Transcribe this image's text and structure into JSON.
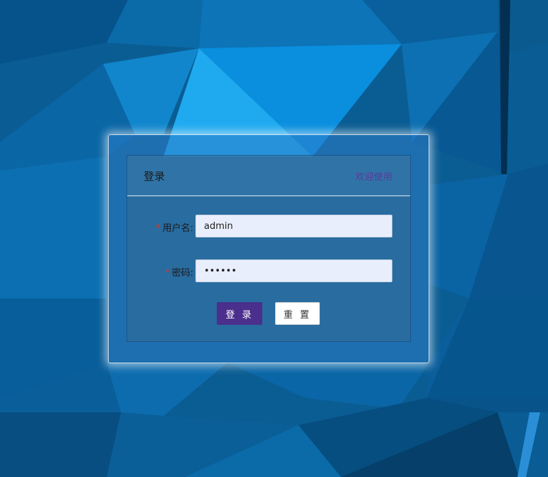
{
  "card": {
    "title": "登录",
    "welcome": "欢迎使用"
  },
  "form": {
    "username_label": "用户名:",
    "username_value": "admin",
    "password_label": "密码:",
    "password_value": "123456",
    "required_mark": "*"
  },
  "buttons": {
    "login_label": "登 录",
    "reset_label": "重 置"
  },
  "colors": {
    "primary_button": "#4a2f8c",
    "required_mark": "#e0302a",
    "welcome_text": "#5a3a9a"
  }
}
